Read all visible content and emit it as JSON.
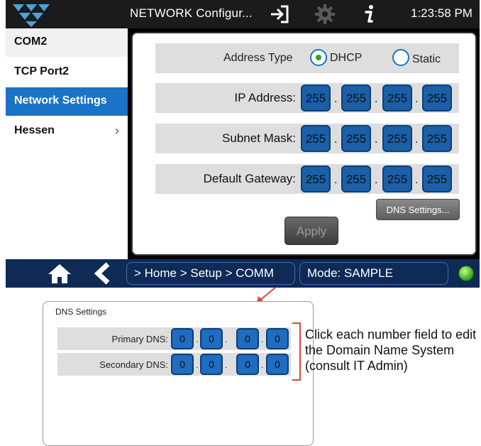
{
  "header": {
    "title": "NETWORK Configur...",
    "clock": "1:23:58 PM",
    "icons": [
      "logo-icon",
      "sign-in-icon",
      "gear-icon",
      "info-icon"
    ]
  },
  "sidebar": {
    "items": [
      {
        "label": "COM2",
        "active": false
      },
      {
        "label": "TCP Port2",
        "active": false
      },
      {
        "label": "Network Settings",
        "active": true
      },
      {
        "label": "Hessen",
        "active": false,
        "chevron": "›"
      }
    ]
  },
  "network": {
    "address_type_label": "Address Type",
    "dhcp_label": "DHCP",
    "static_label": "Static",
    "selected": "DHCP",
    "ip_label": "IP Address:",
    "ip": [
      "255",
      "255",
      "255",
      "255"
    ],
    "subnet_label": "Subnet Mask:",
    "subnet": [
      "255",
      "255",
      "255",
      "255"
    ],
    "gateway_label": "Default Gateway:",
    "gateway": [
      "255",
      "255",
      "255",
      "255"
    ],
    "separator": ".",
    "dns_button": "DNS Settings...",
    "apply_button": "Apply"
  },
  "footer": {
    "breadcrumb": "> Home > Setup > COMM",
    "mode": "Mode: SAMPLE",
    "status_color": "#2fa316"
  },
  "dns_dialog": {
    "title": "DNS Settings",
    "primary_label": "Primary DNS:",
    "primary": [
      "0",
      "0",
      "0",
      "0"
    ],
    "secondary_label": "Secondary DNS:",
    "secondary": [
      "0",
      "0",
      "0",
      "0"
    ],
    "separator": "."
  },
  "annotation": {
    "text": "Click each number field to edit the Domain Name System (consult IT Admin)",
    "color": "#d9463b"
  },
  "colors": {
    "accent": "#1a73c7",
    "field": "#1a5fa8",
    "bottom_bar": "#0f2a55"
  }
}
